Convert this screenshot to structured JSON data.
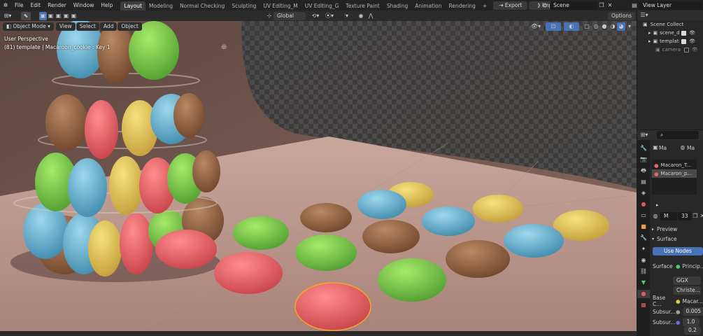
{
  "menubar": {
    "items": [
      "File",
      "Edit",
      "Render",
      "Window",
      "Help"
    ],
    "workspaces": [
      "Layout",
      "Modeling",
      "Normal Checking",
      "Sculpting",
      "UV Editing_M",
      "UV Editing_G",
      "Texture Paint",
      "Shading",
      "Animation",
      "Rendering"
    ],
    "active_workspace": "Layout",
    "add_tab": "+",
    "export_label": "Export",
    "import_label": "Import",
    "scene_name": "Scene",
    "view_layer": "View Layer"
  },
  "toolheader": {
    "transform_orientation": "Global",
    "options_label": "Options"
  },
  "viewheader": {
    "mode": "Object Mode",
    "menus": [
      "View",
      "Select",
      "Add",
      "Object"
    ]
  },
  "viewport": {
    "perspective_label": "User Perspective",
    "object_info": "(81) template | Macaroon_cookie : Key 1"
  },
  "outliner": {
    "root": "Scene Collect",
    "items": [
      {
        "label": "scene_di"
      },
      {
        "label": "template"
      },
      {
        "label": "camera"
      }
    ]
  },
  "properties": {
    "tab_ma_1": "Ma",
    "tab_ma_2": "Ma",
    "materials": [
      "Macaron_T...",
      "Macaron_p..."
    ],
    "slot_name": "M",
    "user_count": "33",
    "preview_label": "Preview",
    "surface_panel": "Surface",
    "use_nodes": "Use Nodes",
    "surface_label": "Surface",
    "surface_value": "Princip...",
    "distribution": "GGX",
    "subsurface_method": "Christe...",
    "base_color_label": "Base C...",
    "base_color_value": "Macar...",
    "subsurface_label": "Subsur...",
    "subsurface_value": "0.005",
    "subsurface_radius_label": "Subsur...",
    "subsurface_radius": [
      "1.0",
      "0.2"
    ]
  },
  "colors": {
    "accent": "#4772b3",
    "active_tab": "#3d3d3d",
    "viewport_wall": "#6b4f48",
    "floor": "#c09d93"
  }
}
